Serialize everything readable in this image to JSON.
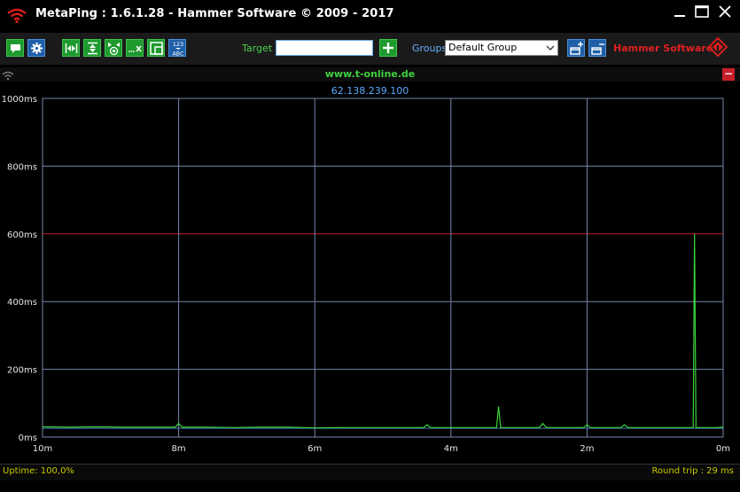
{
  "window": {
    "title": "MetaPing : 1.6.1.28 - Hammer Software © 2009 - 2017",
    "minimize_label": "—",
    "maximize_label": "☐",
    "close_label": "✕"
  },
  "toolbar": {
    "target_label": "Target",
    "target_value": "",
    "groups_label": "Groups",
    "groups_value": "Default Group",
    "brand": "Hammer Software"
  },
  "monitor": {
    "host": "www.t-online.de",
    "ip": "62.138.239.100",
    "close_label": "−"
  },
  "status": {
    "uptime": "Uptime: 100,0%",
    "round_trip": "Round trip : 29 ms"
  },
  "colors": {
    "line": "#3ad43a",
    "grid": "#7486ad",
    "threshold": "#c02020",
    "baseline": "#5aa8ff"
  },
  "chart_data": {
    "type": "line",
    "xlabel": "",
    "ylabel": "",
    "y_ticks": [
      "1000ms",
      "800ms",
      "600ms",
      "400ms",
      "200ms",
      "0ms"
    ],
    "x_ticks": [
      "10m",
      "8m",
      "6m",
      "4m",
      "2m",
      "0m"
    ],
    "xlim": [
      10,
      0
    ],
    "ylim": [
      0,
      1000
    ],
    "grid": true,
    "threshold_ms": 600,
    "series": [
      {
        "values": [
          [
            10,
            30
          ],
          [
            9.6,
            29
          ],
          [
            9.2,
            30
          ],
          [
            8.8,
            29
          ],
          [
            8.4,
            29
          ],
          [
            8.05,
            29
          ],
          [
            8.0,
            40
          ],
          [
            7.95,
            29
          ],
          [
            7.6,
            29
          ],
          [
            7.2,
            28
          ],
          [
            6.8,
            29
          ],
          [
            6.4,
            29
          ],
          [
            6.0,
            27
          ],
          [
            5.6,
            28
          ],
          [
            5.2,
            28
          ],
          [
            4.8,
            28
          ],
          [
            4.4,
            28
          ],
          [
            4.35,
            36
          ],
          [
            4.3,
            28
          ],
          [
            4.0,
            28
          ],
          [
            3.6,
            28
          ],
          [
            3.33,
            28
          ],
          [
            3.3,
            90
          ],
          [
            3.27,
            28
          ],
          [
            3.0,
            28
          ],
          [
            2.8,
            28
          ],
          [
            2.7,
            28
          ],
          [
            2.65,
            40
          ],
          [
            2.6,
            28
          ],
          [
            2.2,
            28
          ],
          [
            2.05,
            28
          ],
          [
            2.0,
            36
          ],
          [
            1.95,
            28
          ],
          [
            1.6,
            28
          ],
          [
            1.5,
            28
          ],
          [
            1.45,
            36
          ],
          [
            1.4,
            28
          ],
          [
            1.0,
            28
          ],
          [
            0.5,
            28
          ],
          [
            0.44,
            28
          ],
          [
            0.42,
            600
          ],
          [
            0.4,
            28
          ],
          [
            0.3,
            28
          ],
          [
            0.1,
            28
          ],
          [
            0,
            29
          ]
        ]
      }
    ]
  }
}
